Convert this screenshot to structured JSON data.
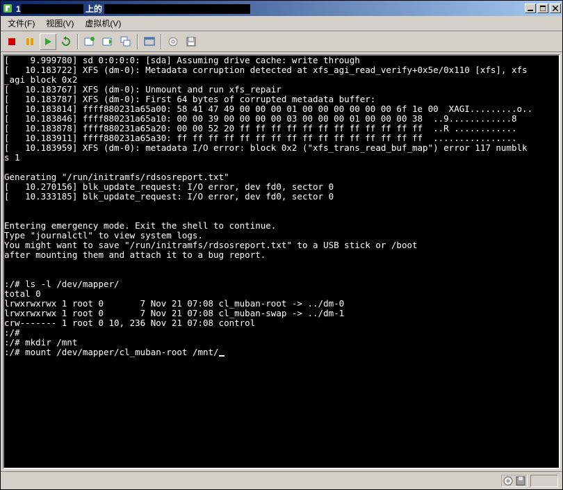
{
  "window": {
    "icon_color": "#5fbf3f",
    "title_prefix": "1",
    "title_blackout_left": " ",
    "title_mid": " 上的 ",
    "title_blackout_right": " "
  },
  "menus": {
    "file": "文件(F)",
    "view": "视图(V)",
    "vm": "虚拟机(V)"
  },
  "toolbar_icons": {
    "stop": "stop-icon",
    "pause": "pause-icon",
    "play": "play-icon",
    "reset": "reset-icon",
    "snapshot": "snapshot-icon",
    "snapshot_revert": "snapshot-revert-icon",
    "snapshot_manage": "snapshot-manage-icon",
    "fullscreen": "fullscreen-icon",
    "cd": "cd-icon",
    "floppy": "floppy-icon"
  },
  "console_lines": [
    "[    9.999780] sd 0:0:0:0: [sda] Assuming drive cache: write through",
    "[   10.183722] XFS (dm-0): Metadata corruption detected at xfs_agi_read_verify+0x5e/0x110 [xfs], xfs",
    "_agi block 0x2",
    "[   10.183767] XFS (dm-0): Unmount and run xfs_repair",
    "[   10.183787] XFS (dm-0): First 64 bytes of corrupted metadata buffer:",
    "[   10.183814] ffff880231a65a00: 58 41 47 49 00 00 00 01 00 00 00 00 00 00 6f 1e 00  XAGI.........o..",
    "[   10.183846] ffff880231a65a10: 00 00 39 00 00 00 00 03 00 00 00 01 00 00 00 38  ..9............8",
    "[   10.183878] ffff880231a65a20: 00 00 52 20 ff ff ff ff ff ff ff ff ff ff ff ff  ..R ............",
    "[   10.183911] ffff880231a65a30: ff ff ff ff ff ff ff ff ff ff ff ff ff ff ff ff  ................",
    "[   10.183959] XFS (dm-0): metadata I/O error: block 0x2 (\"xfs_trans_read_buf_map\") error 117 numblk",
    "s 1",
    "",
    "Generating \"/run/initramfs/rdsosreport.txt\"",
    "[   10.270156] blk_update_request: I/O error, dev fd0, sector 0",
    "[   10.333185] blk_update_request: I/O error, dev fd0, sector 0",
    "",
    "",
    "Entering emergency mode. Exit the shell to continue.",
    "Type \"journalctl\" to view system logs.",
    "You might want to save \"/run/initramfs/rdsosreport.txt\" to a USB stick or /boot",
    "after mounting them and attach it to a bug report.",
    "",
    "",
    ":/# ls -l /dev/mapper/",
    "total 0",
    "lrwxrwxrwx 1 root 0       7 Nov 21 07:08 cl_muban-root -> ../dm-0",
    "lrwxrwxrwx 1 root 0       7 Nov 21 07:08 cl_muban-swap -> ../dm-1",
    "crw------- 1 root 0 10, 236 Nov 21 07:08 control",
    ":/#",
    ":/# mkdir /mnt",
    ":/# mount /dev/mapper/cl_muban-root /mnt/"
  ],
  "colors": {
    "titlebar_start": "#0a246a",
    "titlebar_end": "#a6caf0",
    "chrome": "#d4d0c8",
    "console_bg": "#000000",
    "console_fg": "#ffffff"
  }
}
